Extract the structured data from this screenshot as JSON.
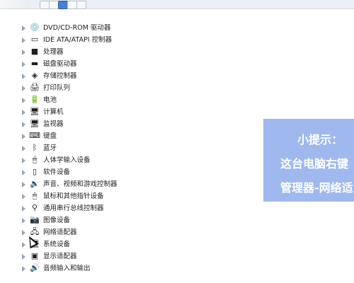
{
  "device_manager": {
    "items": [
      {
        "label": "DVD/CD-ROM 驱动器",
        "icon": "disc-drive-icon"
      },
      {
        "label": "IDE ATA/ATAPI 控制器",
        "icon": "ide-controller-icon"
      },
      {
        "label": "处理器",
        "icon": "processor-icon"
      },
      {
        "label": "磁盘驱动器",
        "icon": "disk-drive-icon"
      },
      {
        "label": "存储控制器",
        "icon": "storage-controller-icon"
      },
      {
        "label": "打印队列",
        "icon": "printer-icon"
      },
      {
        "label": "电池",
        "icon": "battery-icon"
      },
      {
        "label": "计算机",
        "icon": "computer-icon"
      },
      {
        "label": "监视器",
        "icon": "monitor-icon"
      },
      {
        "label": "键盘",
        "icon": "keyboard-icon"
      },
      {
        "label": "蓝牙",
        "icon": "bluetooth-icon"
      },
      {
        "label": "人体学输入设备",
        "icon": "human-input-icon"
      },
      {
        "label": "软件设备",
        "icon": "software-device-icon"
      },
      {
        "label": "声音、视频和游戏控制器",
        "icon": "audio-icon"
      },
      {
        "label": "鼠标和其他指针设备",
        "icon": "mouse-icon"
      },
      {
        "label": "通用串行总线控制器",
        "icon": "usb-icon"
      },
      {
        "label": "图像设备",
        "icon": "camera-icon"
      },
      {
        "label": "网络适配器",
        "icon": "network-adapter-icon"
      },
      {
        "label": "系统设备",
        "icon": "system-device-icon"
      },
      {
        "label": "显示适配器",
        "icon": "display-adapter-icon"
      },
      {
        "label": "音频输入和输出",
        "icon": "audio-io-icon"
      }
    ]
  },
  "tip": {
    "title": "小提示：",
    "line1": "这台电脑右键",
    "line2": "管理器-网络适"
  },
  "colors": {
    "tip_background": "#9fb8ee",
    "tip_text": "#ffffff",
    "tree_arrow": "#9aa4b0"
  }
}
